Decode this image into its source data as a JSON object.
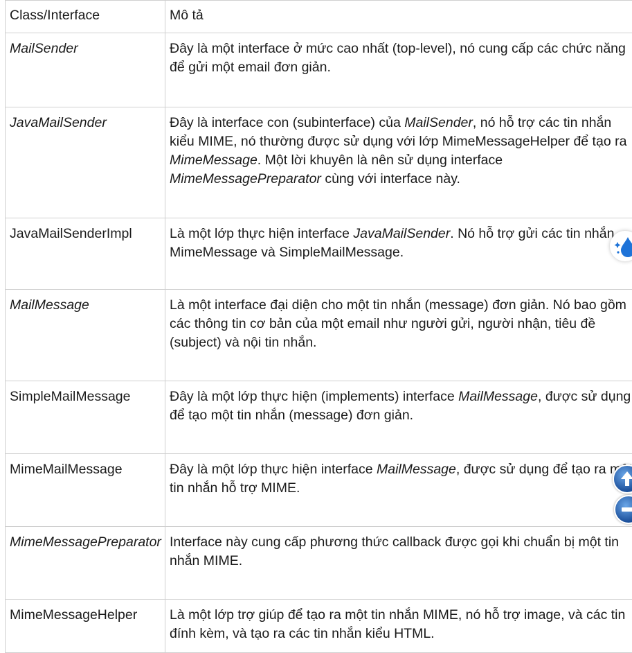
{
  "table": {
    "header": {
      "col1": "Class/Interface",
      "col2": "Mô tả"
    },
    "rows": [
      {
        "name": "MailSender",
        "desc": [
          {
            "t": "Đây là một interface ở mức cao nhất (top-level), nó cung cấp các chức năng để gửi một email đơn giản."
          }
        ]
      },
      {
        "name": "JavaMailSender",
        "desc": [
          {
            "t": "Đây là interface con (subinterface) của "
          },
          {
            "t": "MailSender",
            "i": true
          },
          {
            "t": ", nó hỗ trợ các tin nhắn kiểu MIME, nó thường được sử dụng với lớp MimeMessageHelper để tạo ra "
          },
          {
            "t": "MimeMessage",
            "i": true
          },
          {
            "t": ". Một lời khuyên là nên sử dụng interface "
          },
          {
            "t": "MimeMessagePreparator",
            "i": true
          },
          {
            "t": " cùng với interface này."
          }
        ]
      },
      {
        "name": "JavaMailSenderImpl",
        "desc": [
          {
            "t": "Là một lớp thực hiện interface "
          },
          {
            "t": "JavaMailSender",
            "i": true
          },
          {
            "t": ". Nó hỗ trợ gửi các tin nhắn MimeMessage và SimpleMailMessage."
          }
        ]
      },
      {
        "name": "MailMessage",
        "desc": [
          {
            "t": "Là một interface đại diện cho một tin nhắn (message) đơn giản. Nó bao gồm các thông tin cơ bản của một email như người gửi, người nhận, tiêu đề (subject) và nội tin nhắn."
          }
        ]
      },
      {
        "name": "SimpleMailMessage",
        "desc": [
          {
            "t": "Đây là một lớp thực hiện (implements) interface "
          },
          {
            "t": "MailMessage",
            "i": true
          },
          {
            "t": ", được sử dụng để tạo một tin nhắn (message) đơn giản."
          }
        ]
      },
      {
        "name": "MimeMailMessage",
        "desc": [
          {
            "t": "Đây là một lớp thực hiện interface "
          },
          {
            "t": "MailMessage",
            "i": true
          },
          {
            "t": ", được sử dụng để tạo ra một tin nhắn hỗ trợ MIME."
          }
        ]
      },
      {
        "name": "MimeMessagePreparator",
        "desc": [
          {
            "t": "Interface này cung cấp phương thức callback được gọi khi chuẩn bị một tin nhắn MIME."
          }
        ]
      },
      {
        "name": "MimeMessageHelper",
        "desc": [
          {
            "t": "Là một lớp trợ giúp để tạo ra một tin nhắn MIME, nó hỗ trợ image, và các tin đính kèm, và tạo ra các tin nhắn kiểu HTML."
          }
        ]
      }
    ]
  },
  "widgets": {
    "water_icon": "water-drop-icon",
    "up_icon": "arrow-up-icon",
    "down_icon": "minus-icon",
    "accent": "#1b4f9a"
  }
}
